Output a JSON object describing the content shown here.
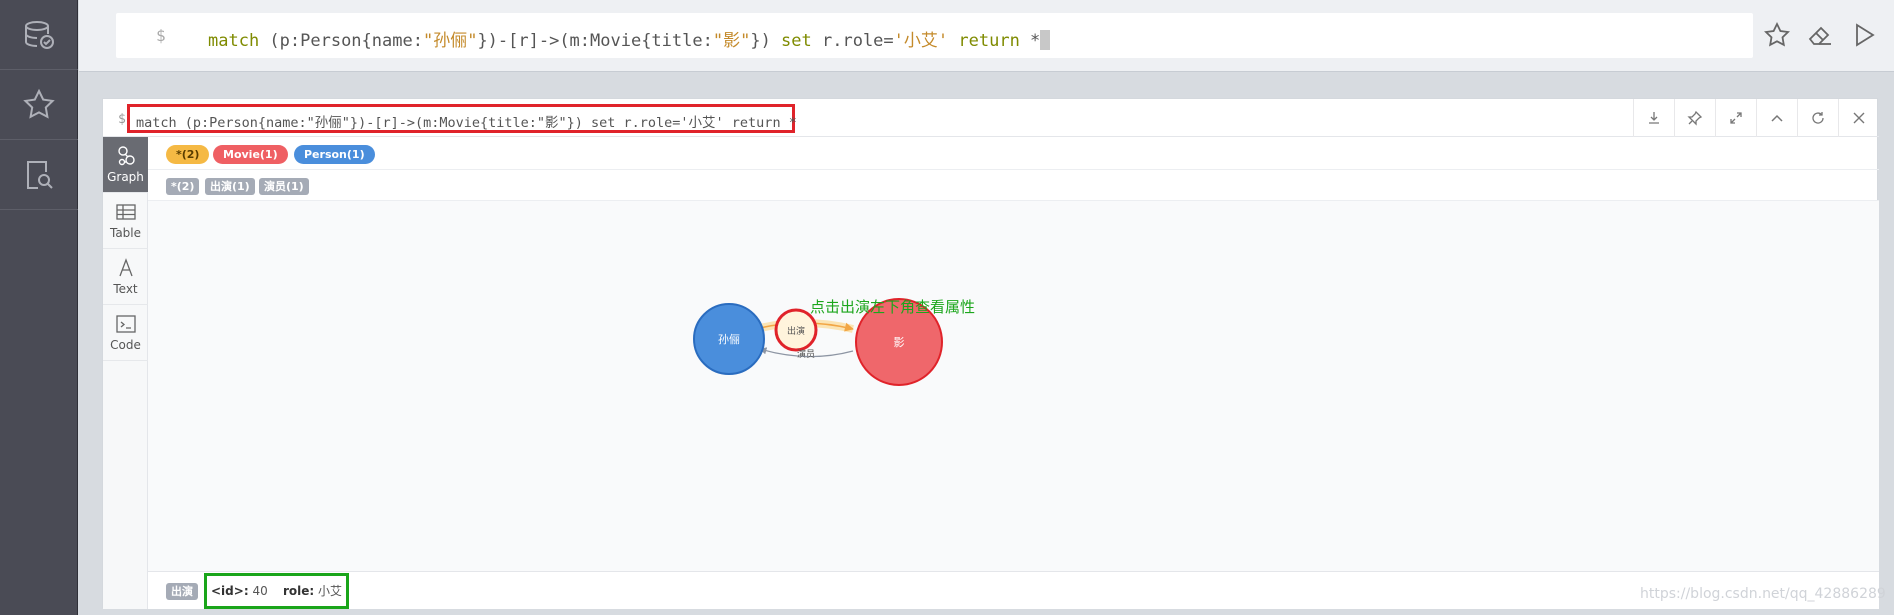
{
  "sidebar": {
    "items": [
      {
        "name": "database",
        "icon": "database-check-icon"
      },
      {
        "name": "favorites",
        "icon": "star-icon"
      },
      {
        "name": "documents",
        "icon": "document-search-icon"
      }
    ]
  },
  "editor": {
    "prompt": "$",
    "query_parts": {
      "match": "match",
      "p1": " (p:Person{name:",
      "name_val": "\"孙俪\"",
      "p2": "})-[r]->(m:Movie{title:",
      "title_val": "\"影\"",
      "p3": "}) ",
      "set": "set",
      "p4": " r.role=",
      "role_val": "'小艾'",
      "p5": " ",
      "ret": "return",
      "p6": " *"
    },
    "actions": [
      "star-icon",
      "eraser-icon",
      "play-icon"
    ]
  },
  "result": {
    "prompt": "$",
    "query": "match (p:Person{name:\"孙俪\"})-[r]->(m:Movie{title:\"影\"}) set r.role='小艾' return *",
    "header_actions": [
      "download-icon",
      "pin-icon",
      "expand-icon",
      "collapse-icon",
      "rerun-icon",
      "close-icon"
    ],
    "view_tabs": [
      {
        "label": "Graph",
        "active": true
      },
      {
        "label": "Table",
        "active": false
      },
      {
        "label": "Text",
        "active": false
      },
      {
        "label": "Code",
        "active": false
      }
    ],
    "node_labels": [
      {
        "label": "*(2)",
        "color": "#f5b944"
      },
      {
        "label": "Movie(1)",
        "color": "#ef5f63"
      },
      {
        "label": "Person(1)",
        "color": "#4a8edc"
      }
    ],
    "rel_types": [
      "*(2)",
      "出演(1)",
      "演员(1)"
    ],
    "annotation": "点击出演左下角查看属性",
    "graph": {
      "nodes": [
        {
          "label": "孙俪",
          "color": "#4a8edc",
          "border": "#2a6cbf"
        },
        {
          "label": "影",
          "color": "#ef676b",
          "border": "#e0232a"
        }
      ],
      "edges": [
        {
          "label": "出演",
          "highlighted": true
        },
        {
          "label": "演员",
          "highlighted": false
        }
      ]
    },
    "properties": {
      "type": "出演",
      "id_key": "<id>:",
      "id_value": "40",
      "role_key": "role:",
      "role_value": "小艾"
    }
  },
  "watermark": "https://blog.csdn.net/qq_42886289"
}
